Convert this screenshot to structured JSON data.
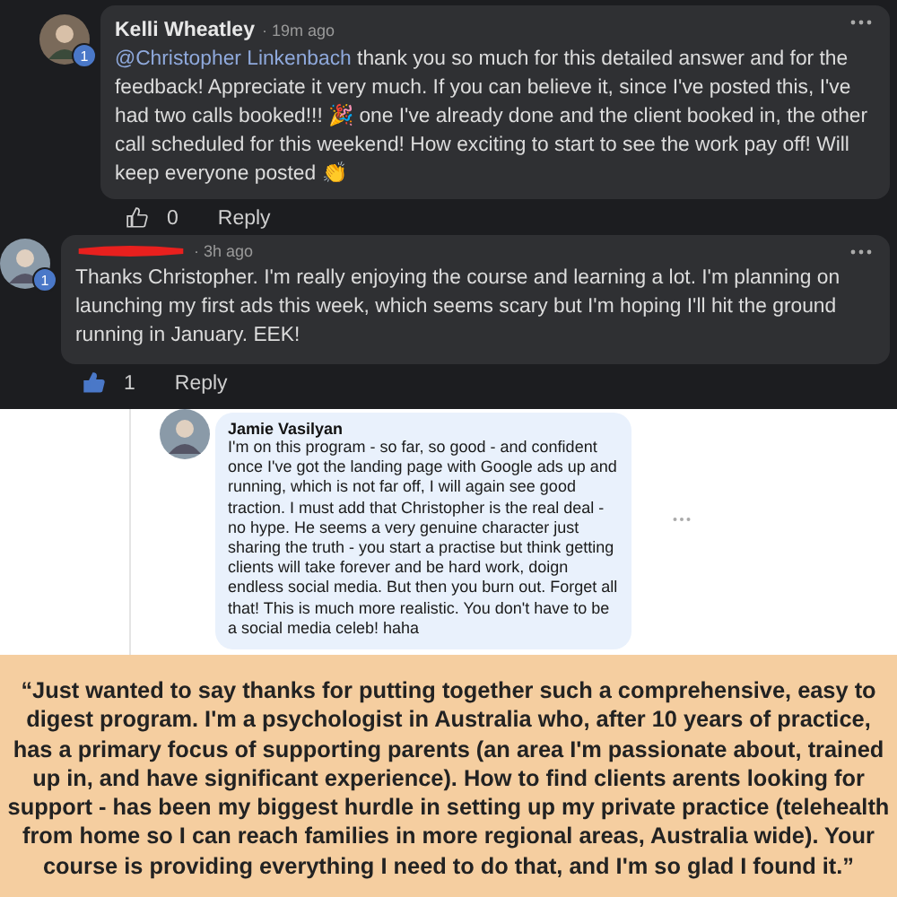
{
  "comments": [
    {
      "author": "Kelli Wheatley",
      "redacted": false,
      "time": "· 19m ago",
      "badge": "1",
      "mention": "@Christopher Linkenbach",
      "text": " thank you so much for this detailed answer and for the feedback! Appreciate it very much. If you can believe it, since I've posted this, I've had two calls booked!!! 🎉 one I've already done and the client booked in, the other call scheduled for this weekend! How exciting to start to see the work pay off! Will keep everyone posted 👏",
      "likes": "0",
      "liked": false,
      "reply": "Reply"
    },
    {
      "redacted": true,
      "time": "· 3h ago",
      "badge": "1",
      "text": "Thanks Christopher. I'm really enjoying the course and learning a lot. I'm planning on launching my first ads this week, which seems scary but I'm hoping I'll hit the ground running in January. EEK!",
      "likes": "1",
      "liked": true,
      "reply": "Reply"
    }
  ],
  "light_comment": {
    "author": "Jamie Vasilyan",
    "text": "I'm on this program - so far, so good - and confident once I've got the landing page with Google ads up and running, which is not far off, I will again see good traction. I must add that Christopher is the real deal - no hype. He seems a very genuine character just sharing the truth - you start a practise but think getting clients will take forever and be hard work, doign endless social media. But then you burn out. Forget all that! This is much more realistic. You don't have to be a social media celeb! haha"
  },
  "quote": "“Just wanted to say thanks for putting together such a comprehensive, easy to digest program. I'm a psychologist in Australia who, after 10 years of practice, has a primary focus of supporting parents (an area I'm passionate about, trained up in, and have significant experience). How to find clients arents looking for support - has been my biggest hurdle in setting up my private practice (telehealth from home so I can reach families in more regional areas, Australia wide). Your course is providing everything I need to do that, and I'm so glad I found it.”"
}
